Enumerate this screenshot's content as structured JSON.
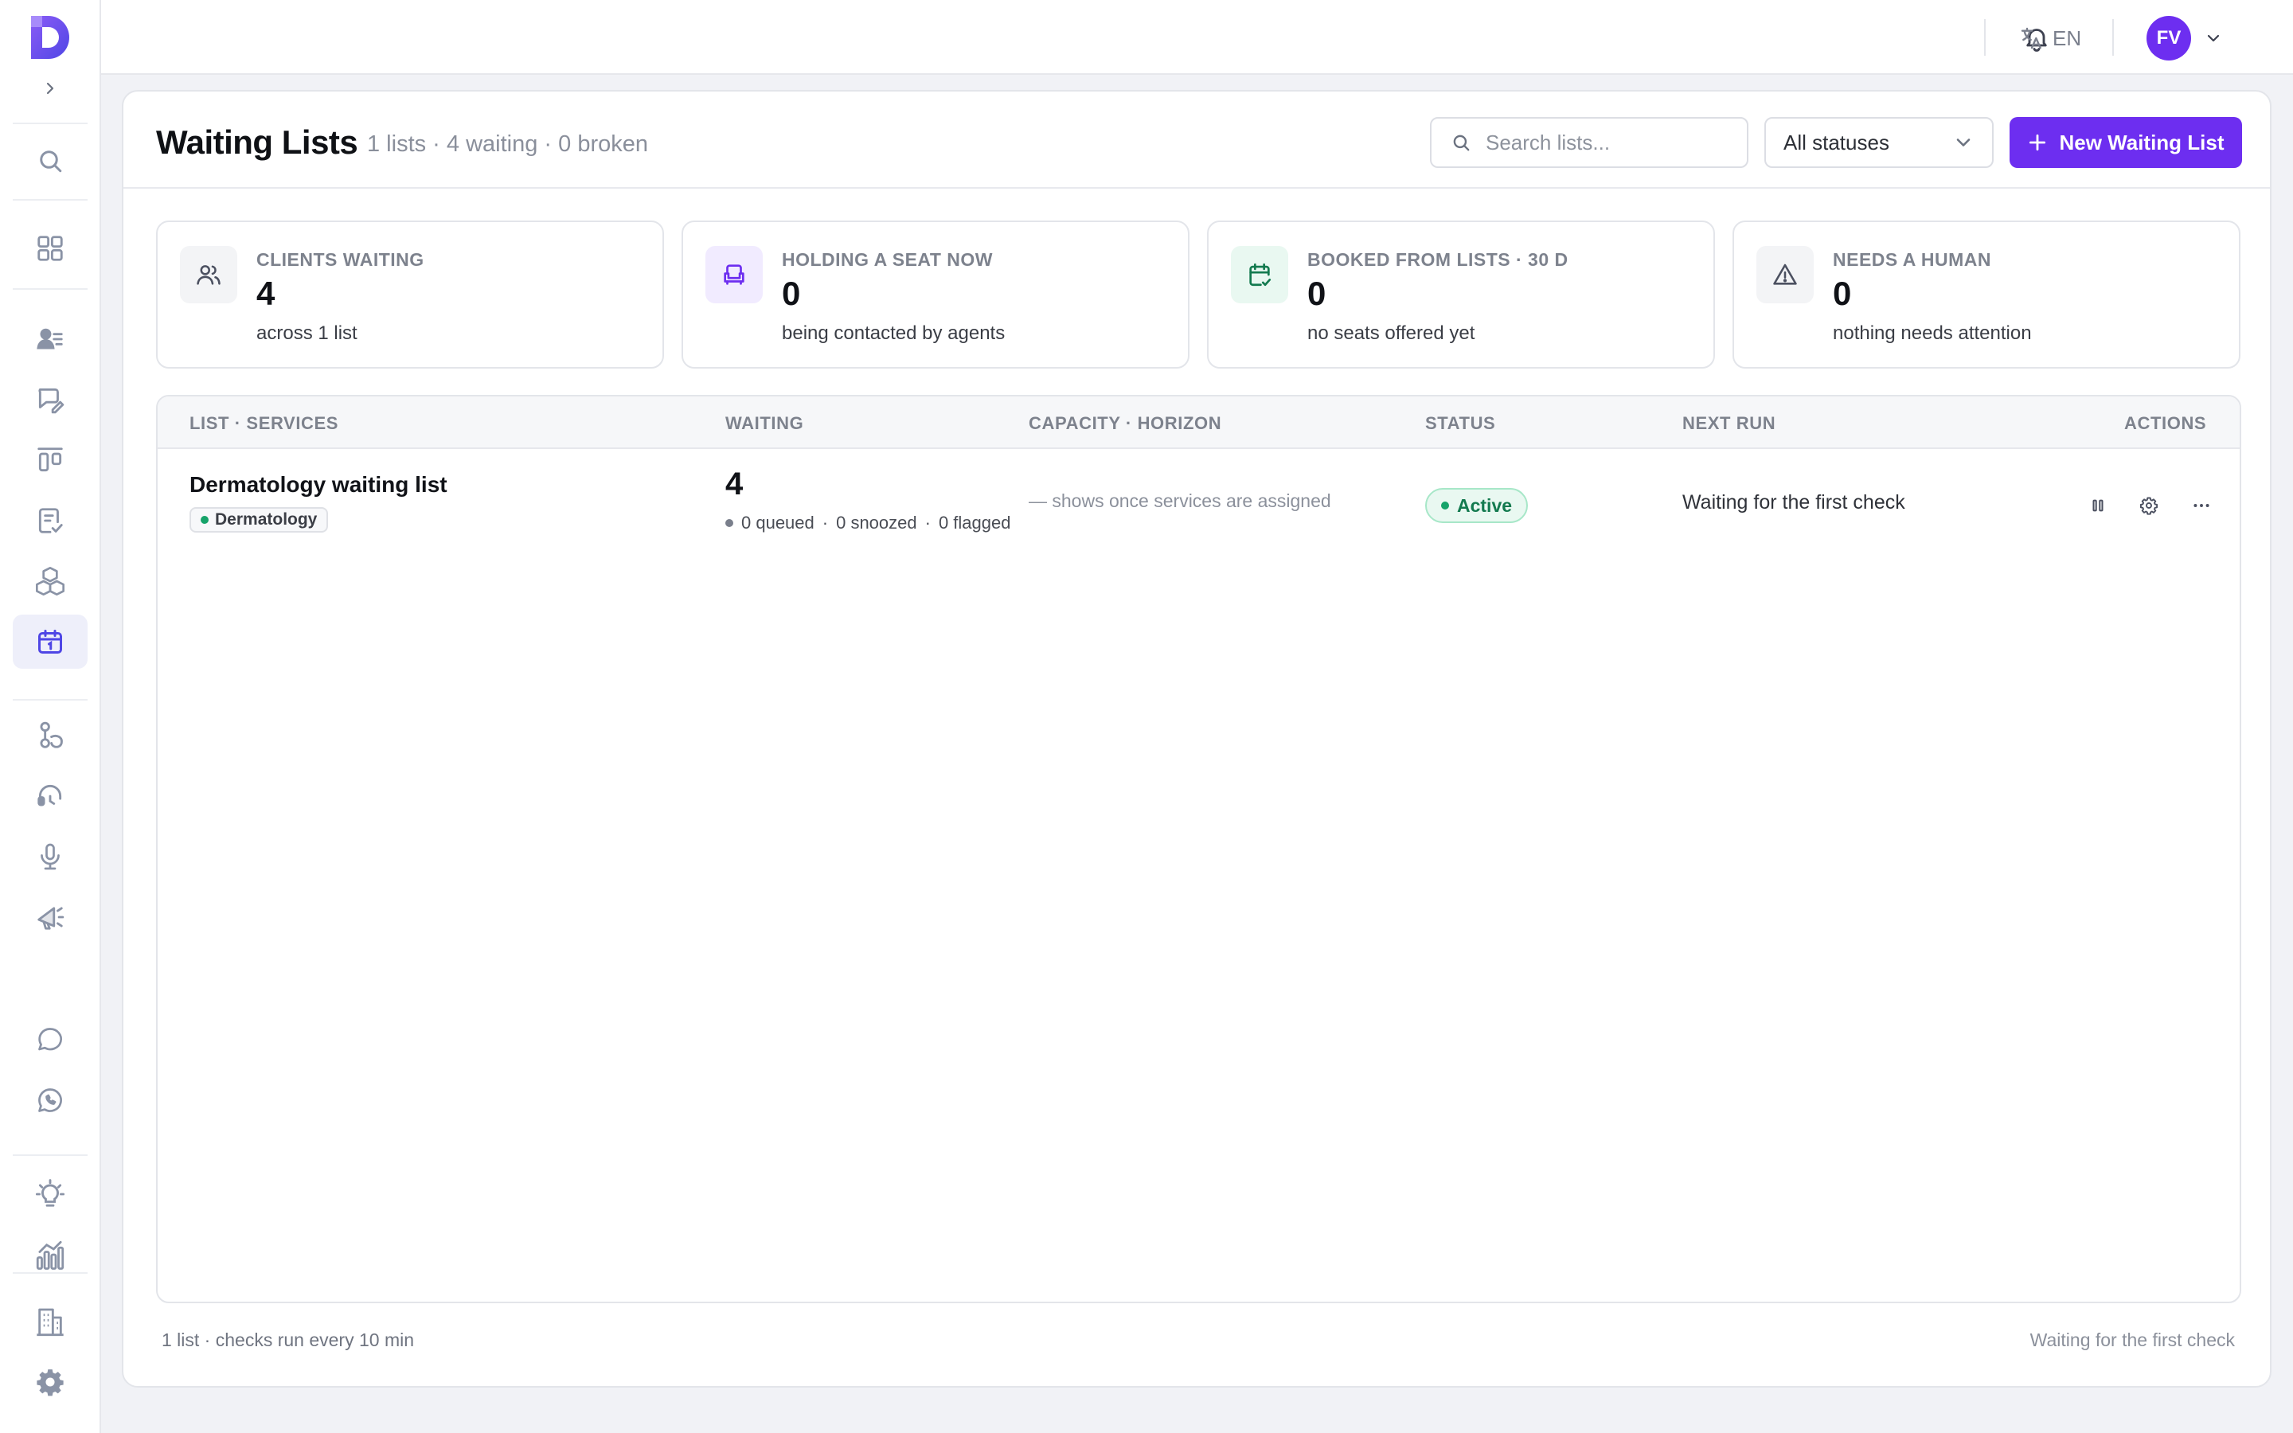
{
  "topbar": {
    "language": "EN",
    "avatar_initials": "FV",
    "icons": [
      "bell-icon",
      "translate-icon",
      "chevron-down-icon"
    ]
  },
  "sidebar": {
    "items": [
      {
        "icon": "search-icon",
        "active": false
      },
      {
        "icon": "grid-icon",
        "active": false
      },
      {
        "icon": "contacts-icon",
        "active": false
      },
      {
        "icon": "chat-edit-icon",
        "active": false
      },
      {
        "icon": "board-icon",
        "active": false
      },
      {
        "icon": "checklist-icon",
        "active": false
      },
      {
        "icon": "boxes-icon",
        "active": false
      },
      {
        "icon": "calendar-icon",
        "active": true
      },
      {
        "icon": "flow-icon",
        "active": false
      },
      {
        "icon": "headset-icon",
        "active": false
      },
      {
        "icon": "microphone-icon",
        "active": false
      },
      {
        "icon": "megaphone-icon",
        "active": false
      },
      {
        "icon": "message-icon",
        "active": false
      },
      {
        "icon": "whatsapp-icon",
        "active": false
      },
      {
        "icon": "lightbulb-icon",
        "active": false
      },
      {
        "icon": "analytics-icon",
        "active": false
      },
      {
        "icon": "building-icon",
        "active": false
      },
      {
        "icon": "gear-icon",
        "active": false
      }
    ]
  },
  "header": {
    "title": "Waiting Lists",
    "subtitle": "1 lists · 4 waiting · 0 broken",
    "search_placeholder": "Search lists...",
    "status_filter": "All statuses",
    "new_button": "New Waiting List"
  },
  "stats": [
    {
      "label": "CLIENTS WAITING",
      "value": "4",
      "note": "across 1 list",
      "icon": "users-icon",
      "color": "#f3f4f6"
    },
    {
      "label": "HOLDING A SEAT NOW",
      "value": "0",
      "note": "being contacted by agents",
      "icon": "armchair-icon",
      "color": "#f1ebff"
    },
    {
      "label": "BOOKED FROM LISTS · 30 D",
      "value": "0",
      "note": "no seats offered yet",
      "icon": "calendar-check-icon",
      "color": "#e9f8f1"
    },
    {
      "label": "NEEDS A HUMAN",
      "value": "0",
      "note": "nothing needs attention",
      "icon": "warning-icon",
      "color": "#f3f4f6"
    }
  ],
  "table": {
    "headers": [
      "LIST · SERVICES",
      "WAITING",
      "CAPACITY · HORIZON",
      "STATUS",
      "NEXT RUN",
      "ACTIONS"
    ],
    "rows": [
      {
        "name": "Dermatology waiting list",
        "service": "Dermatology",
        "waiting": "4",
        "queued": "0 queued",
        "snoozed": "0 snoozed",
        "flagged": "0 flagged",
        "capacity": "— shows once services are assigned",
        "status": "Active",
        "next_run": "Waiting for the first check"
      }
    ]
  },
  "footer": {
    "left": "1 list · checks run every 10 min",
    "right": "Waiting for the first check"
  },
  "colors": {
    "accent": "#6d2ef0",
    "active_green": "#137a4f",
    "service_dot": "#16a36a"
  }
}
